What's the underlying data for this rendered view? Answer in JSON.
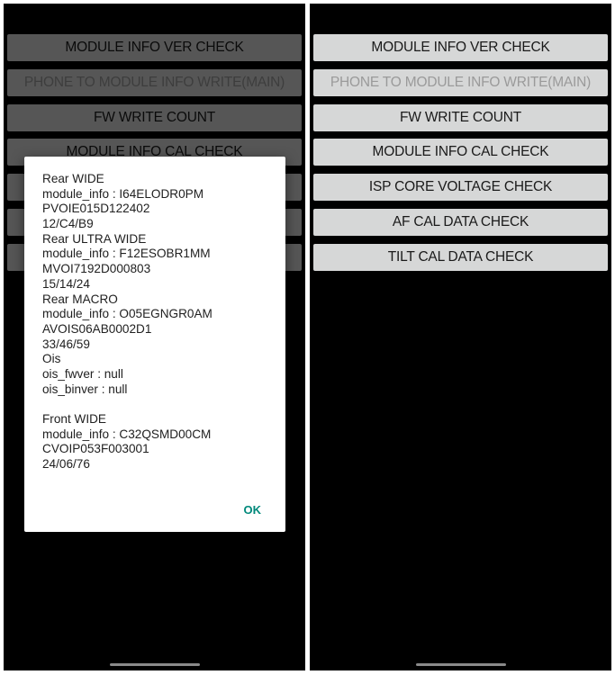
{
  "buttons": [
    {
      "label": "MODULE INFO VER CHECK",
      "enabled": true
    },
    {
      "label": "PHONE TO MODULE INFO WRITE(MAIN)",
      "enabled": false
    },
    {
      "label": "FW WRITE COUNT",
      "enabled": true
    },
    {
      "label": "MODULE INFO CAL CHECK",
      "enabled": true
    },
    {
      "label": "ISP CORE VOLTAGE CHECK",
      "enabled": true
    },
    {
      "label": "AF CAL DATA CHECK",
      "enabled": true
    },
    {
      "label": "TILT CAL DATA CHECK",
      "enabled": true
    }
  ],
  "dialog": {
    "lines": [
      "Rear WIDE",
      "module_info : I64ELODR0PM",
      "PVOIE015D122402",
      "12/C4/B9",
      "Rear ULTRA WIDE",
      "module_info : F12ESOBR1MM",
      "MVOI7192D000803",
      "15/14/24",
      "Rear MACRO",
      "module_info : O05EGNGR0AM",
      "AVOIS06AB0002D1",
      "33/46/59",
      "Ois",
      "ois_fwver : null",
      "ois_binver : null",
      "",
      "Front WIDE",
      "module_info : C32QSMD00CM",
      "CVOIP053F003001",
      "24/06/76"
    ],
    "ok_label": "OK"
  },
  "colors": {
    "button": "#d6d7d7",
    "accent": "#00897b",
    "background": "#000000"
  }
}
